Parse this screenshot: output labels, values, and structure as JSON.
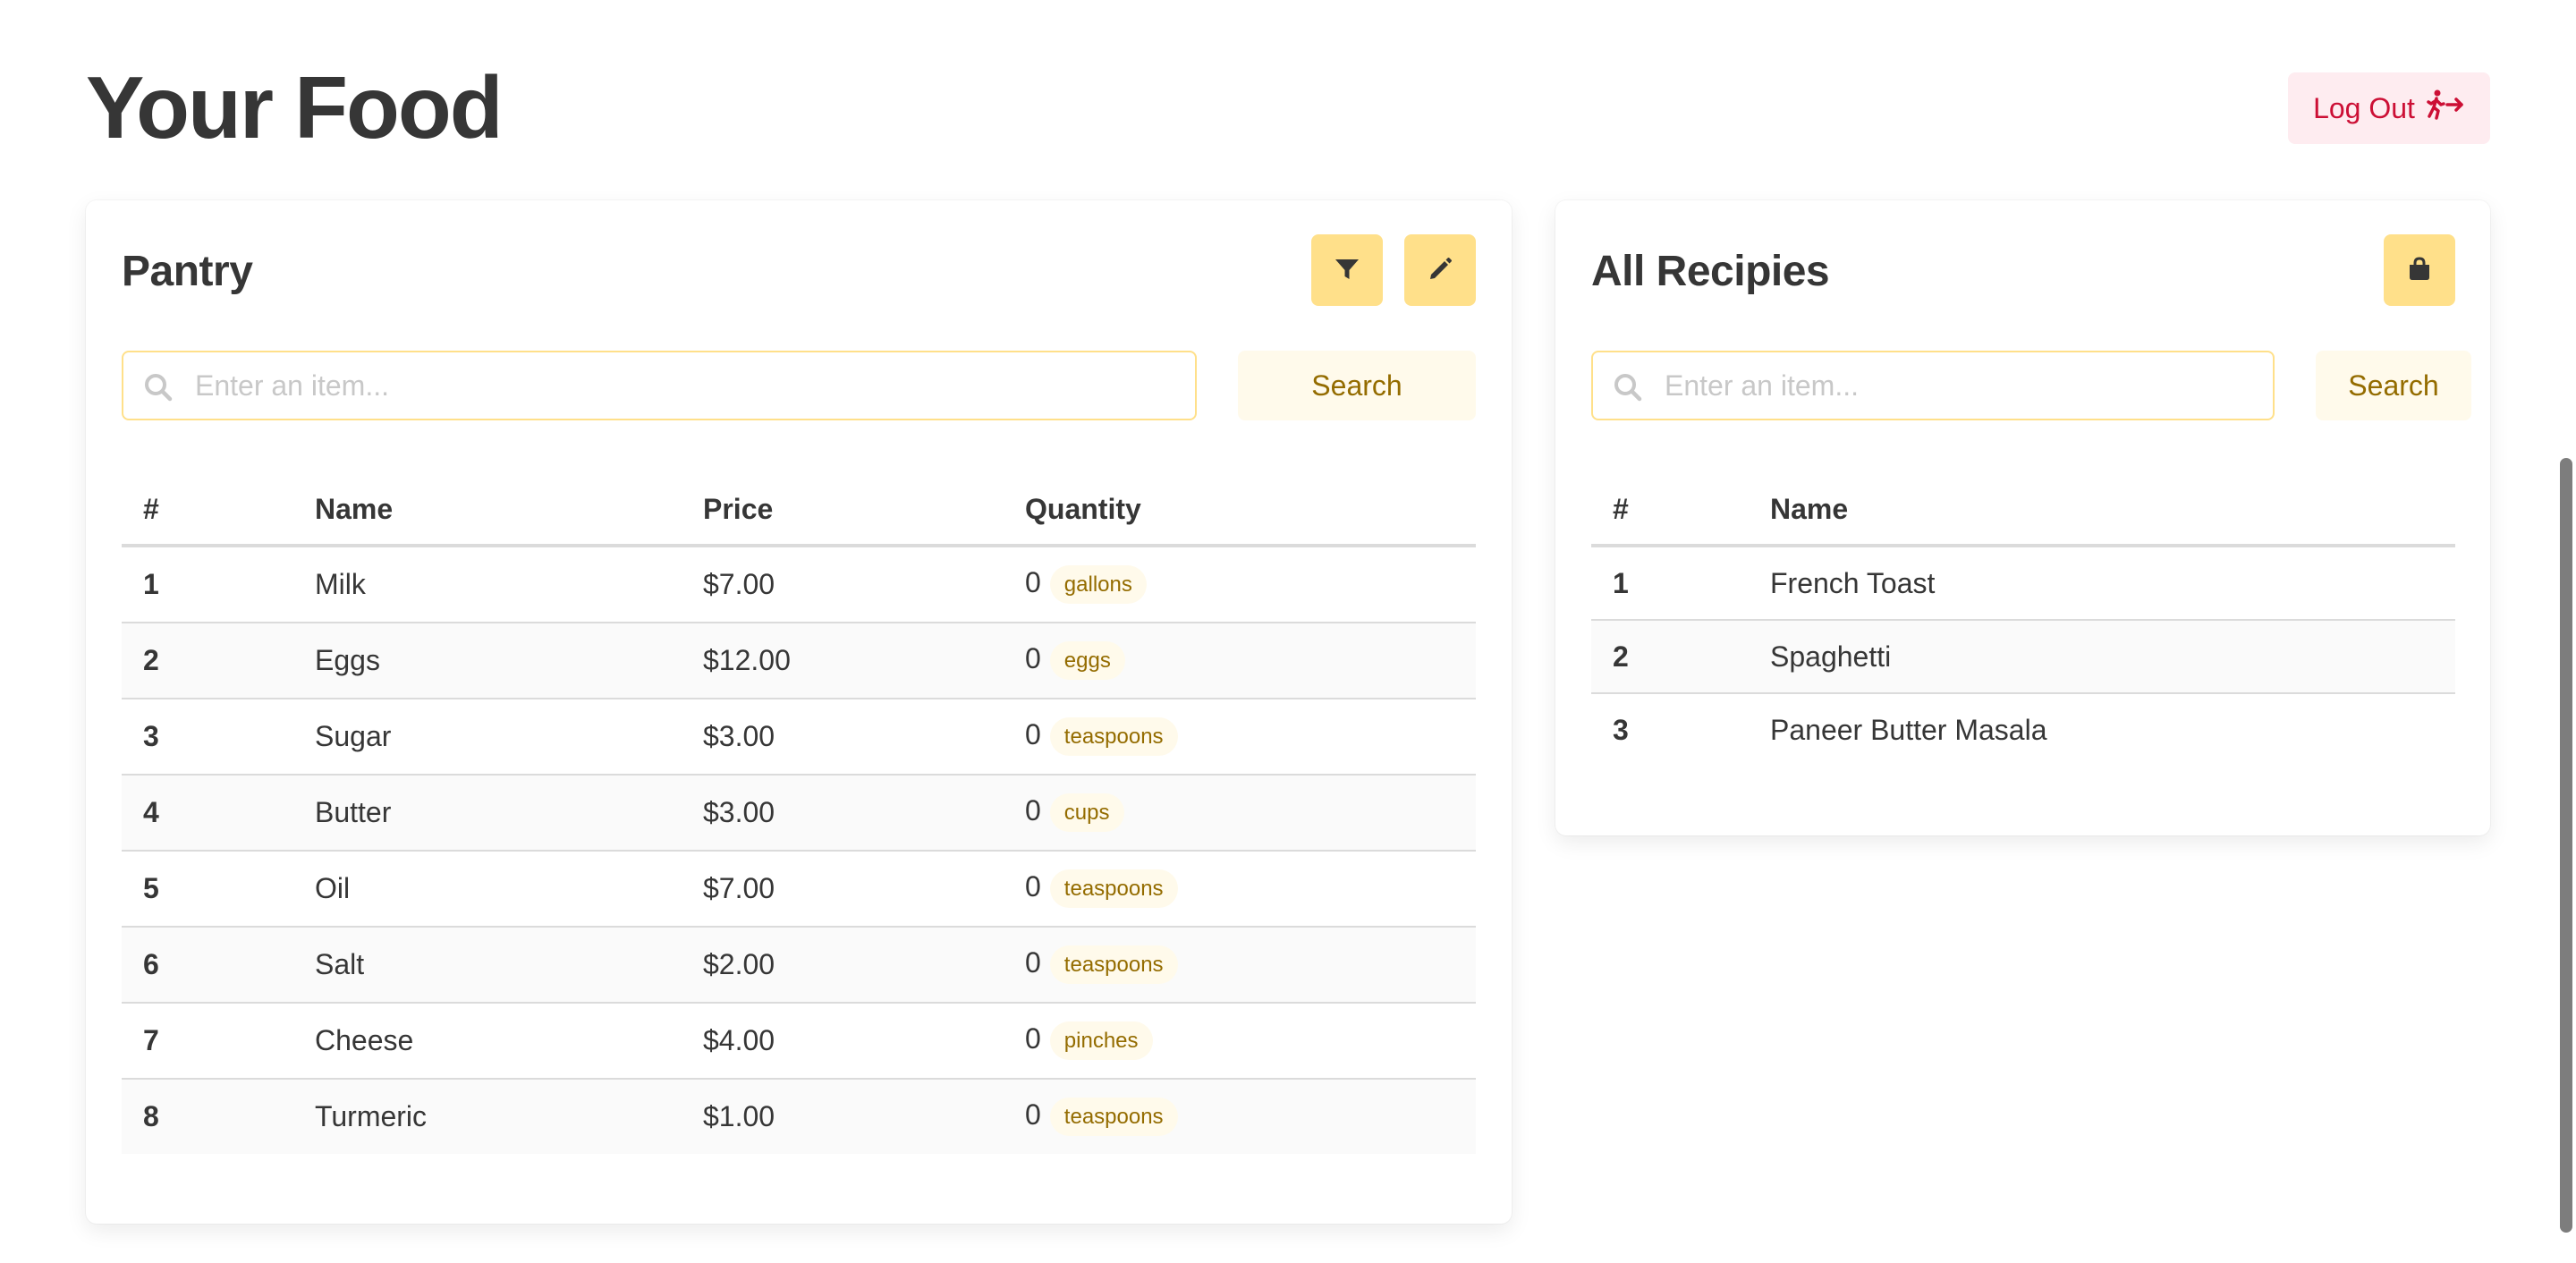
{
  "page": {
    "title": "Your Food",
    "logout_label": "Log Out",
    "logout_icon": "person-running-arrow-icon"
  },
  "colors": {
    "accent": "#ffe08a",
    "accent_light": "#fffaeb",
    "accent_text": "#946c00",
    "danger_light": "#feecf0",
    "danger_text": "#cc0f35",
    "text": "#363636"
  },
  "pantry": {
    "title": "Pantry",
    "filter_icon": "filter-icon",
    "edit_icon": "pencil-icon",
    "search": {
      "placeholder": "Enter an item...",
      "value": "",
      "button_label": "Search"
    },
    "columns": {
      "num": "#",
      "name": "Name",
      "price": "Price",
      "quantity": "Quantity"
    },
    "rows": [
      {
        "num": "1",
        "name": "Milk",
        "price": "$7.00",
        "quantity": "0",
        "unit": "gallons"
      },
      {
        "num": "2",
        "name": "Eggs",
        "price": "$12.00",
        "quantity": "0",
        "unit": "eggs"
      },
      {
        "num": "3",
        "name": "Sugar",
        "price": "$3.00",
        "quantity": "0",
        "unit": "teaspoons"
      },
      {
        "num": "4",
        "name": "Butter",
        "price": "$3.00",
        "quantity": "0",
        "unit": "cups"
      },
      {
        "num": "5",
        "name": "Oil",
        "price": "$7.00",
        "quantity": "0",
        "unit": "teaspoons"
      },
      {
        "num": "6",
        "name": "Salt",
        "price": "$2.00",
        "quantity": "0",
        "unit": "teaspoons"
      },
      {
        "num": "7",
        "name": "Cheese",
        "price": "$4.00",
        "quantity": "0",
        "unit": "pinches"
      },
      {
        "num": "8",
        "name": "Turmeric",
        "price": "$1.00",
        "quantity": "0",
        "unit": "teaspoons"
      }
    ]
  },
  "recipes": {
    "title": "All Recipies",
    "bag_icon": "shopping-bag-icon",
    "search": {
      "placeholder": "Enter an item...",
      "value": "",
      "button_label": "Search"
    },
    "columns": {
      "num": "#",
      "name": "Name"
    },
    "rows": [
      {
        "num": "1",
        "name": "French Toast"
      },
      {
        "num": "2",
        "name": "Spaghetti"
      },
      {
        "num": "3",
        "name": "Paneer Butter Masala"
      }
    ]
  }
}
